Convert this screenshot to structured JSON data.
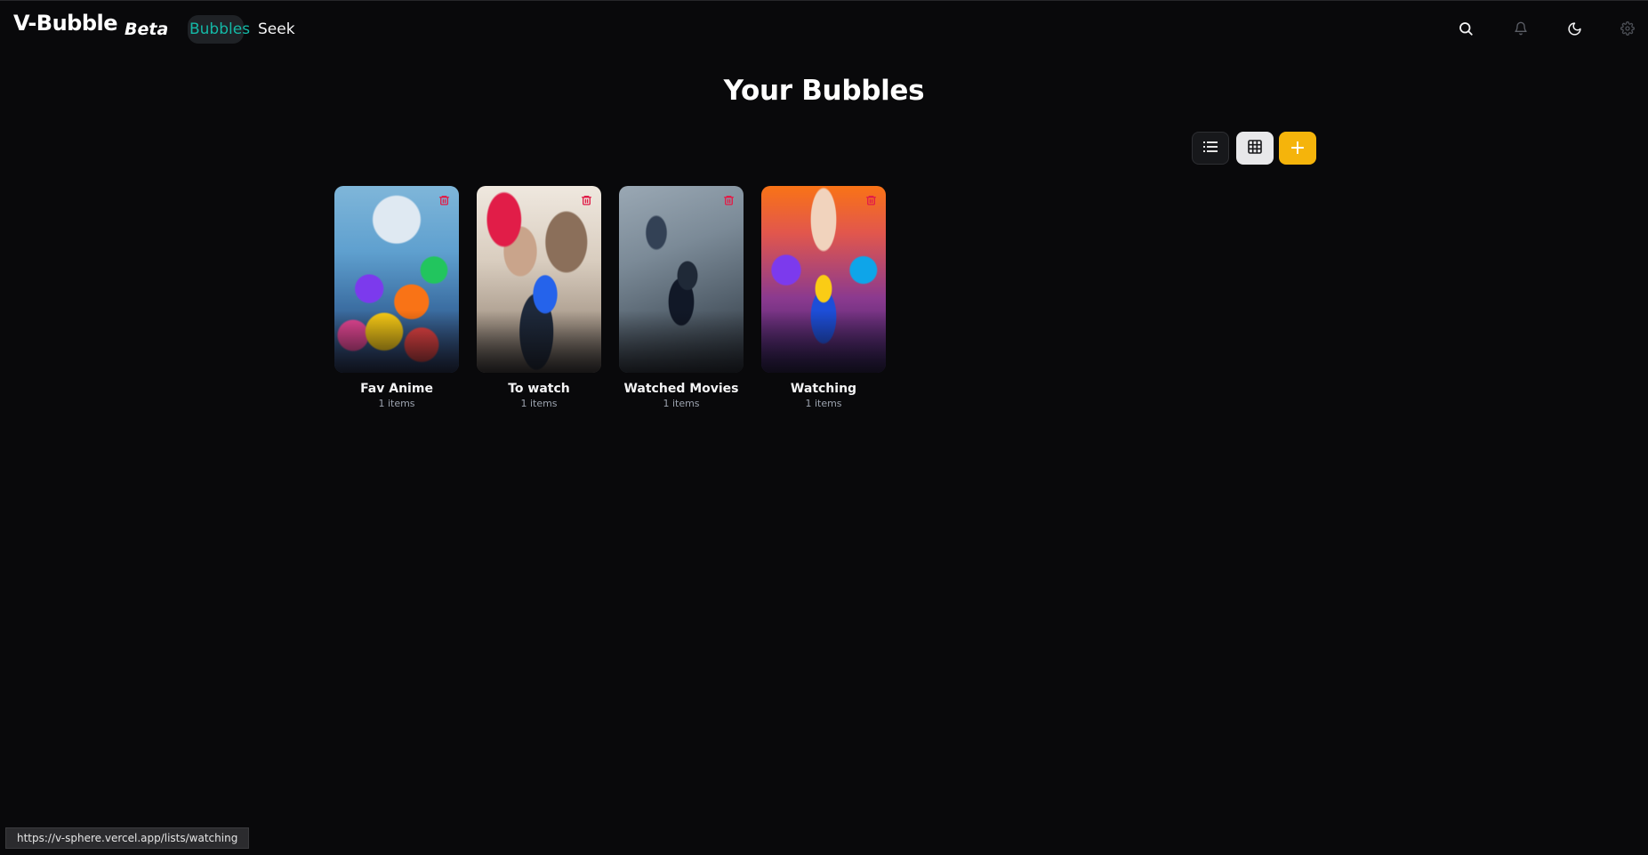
{
  "app": {
    "brand_name": "V-Bubble",
    "brand_tag": "Beta"
  },
  "nav": {
    "items": [
      {
        "label": "Bubbles",
        "active": true
      },
      {
        "label": "Seek",
        "active": false
      }
    ]
  },
  "header_icons": [
    "search-icon",
    "bell-icon",
    "moon-icon",
    "gear-icon"
  ],
  "main": {
    "title": "Your Bubbles",
    "view_controls": [
      "list-view-icon",
      "grid-view-icon",
      "plus-icon"
    ],
    "add_label": "+"
  },
  "bubbles": [
    {
      "title": "Fav Anime",
      "count": "1 items"
    },
    {
      "title": "To watch",
      "count": "1 items"
    },
    {
      "title": "Watched Movies",
      "count": "1 items"
    },
    {
      "title": "Watching",
      "count": "1 items"
    }
  ],
  "status_url": "https://v-sphere.vercel.app/lists/watching",
  "colors": {
    "background": "#09090b",
    "accent_teal": "#14b8a6",
    "add_button": "#f5b40b",
    "trash_red": "#e11d48"
  }
}
